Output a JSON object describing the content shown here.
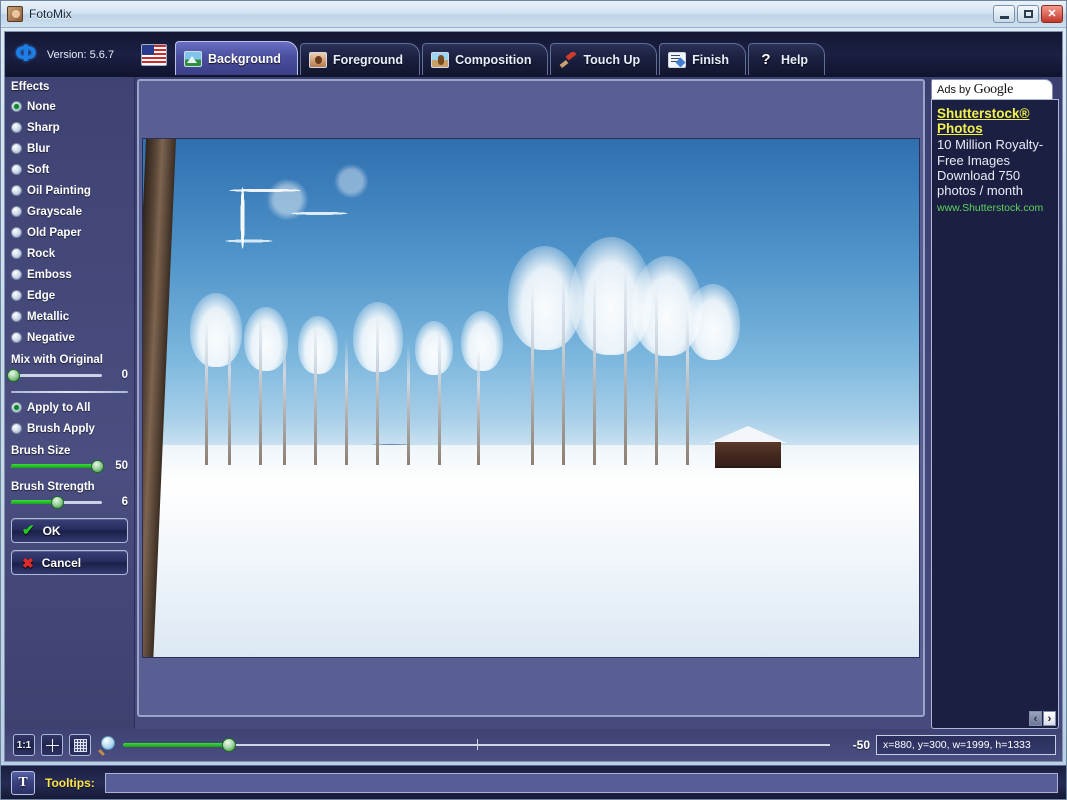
{
  "window": {
    "title": "FotoMix",
    "icon": "app-photo-icon",
    "buttons": {
      "minimize": "_",
      "maximize": "▫",
      "close": "✕"
    }
  },
  "brand": {
    "logo": "Ф",
    "version_label": "Version: 5.6.7",
    "language_flag": "us-flag-icon"
  },
  "tabs": [
    {
      "label": "Background",
      "icon": "landscape-icon",
      "active": true
    },
    {
      "label": "Foreground",
      "icon": "portrait-icon",
      "active": false
    },
    {
      "label": "Composition",
      "icon": "composition-icon",
      "active": false
    },
    {
      "label": "Touch Up",
      "icon": "brush-icon",
      "active": false
    },
    {
      "label": "Finish",
      "icon": "document-icon",
      "active": false
    },
    {
      "label": "Help",
      "icon": "question-icon",
      "active": false
    }
  ],
  "sidebar": {
    "effects_title": "Effects",
    "effects": [
      {
        "label": "None",
        "selected": true
      },
      {
        "label": "Sharp",
        "selected": false
      },
      {
        "label": "Blur",
        "selected": false
      },
      {
        "label": "Soft",
        "selected": false
      },
      {
        "label": "Oil Painting",
        "selected": false
      },
      {
        "label": "Grayscale",
        "selected": false
      },
      {
        "label": "Old Paper",
        "selected": false
      },
      {
        "label": "Rock",
        "selected": false
      },
      {
        "label": "Emboss",
        "selected": false
      },
      {
        "label": "Edge",
        "selected": false
      },
      {
        "label": "Metallic",
        "selected": false
      },
      {
        "label": "Negative",
        "selected": false
      }
    ],
    "mix": {
      "label": "Mix with Original",
      "value": "0",
      "percent": 2
    },
    "apply_modes": [
      {
        "label": "Apply to All",
        "selected": true
      },
      {
        "label": "Brush Apply",
        "selected": false
      }
    ],
    "brush_size": {
      "label": "Brush Size",
      "value": "50",
      "percent": 94
    },
    "brush_strength": {
      "label": "Brush Strength",
      "value": "6",
      "percent": 50
    },
    "ok_button": {
      "label": "OK",
      "icon": "check-icon"
    },
    "cancel_button": {
      "label": "Cancel",
      "icon": "x-icon"
    }
  },
  "bottombar": {
    "zoom_one_to_one": "1:1",
    "fit_to_window": "fit-icon",
    "grid": "grid-icon",
    "magnifier": "magnifier-icon",
    "zoom_value": "-50",
    "zoom_percent": 15,
    "coordinates": "x=880, y=300, w=1999, h=1333"
  },
  "ads": {
    "header_prefix": "Ads by",
    "header_brand": "Google",
    "title": "Shutterstock® Photos",
    "description": "10 Million Royalty-Free Images Download 750 photos / month",
    "url": "www.Shutterstock.com",
    "prev": "‹",
    "next": "›"
  },
  "statusbar": {
    "tooltip_button": "T",
    "tooltip_label": "Tooltips:",
    "tooltip_text": ""
  },
  "canvas": {
    "image_description": "Winter landscape with frost-covered birch trees, snow field and a dark wooden cabin under a blue sky"
  },
  "colors": {
    "accent_green": "#22bb22",
    "panel_purple": "#4a4e80",
    "tab_active": "#4a4e9e",
    "ad_yellow": "#f2f24a",
    "ad_green": "#5fd35f",
    "tooltip_yellow": "#ffe44a"
  }
}
